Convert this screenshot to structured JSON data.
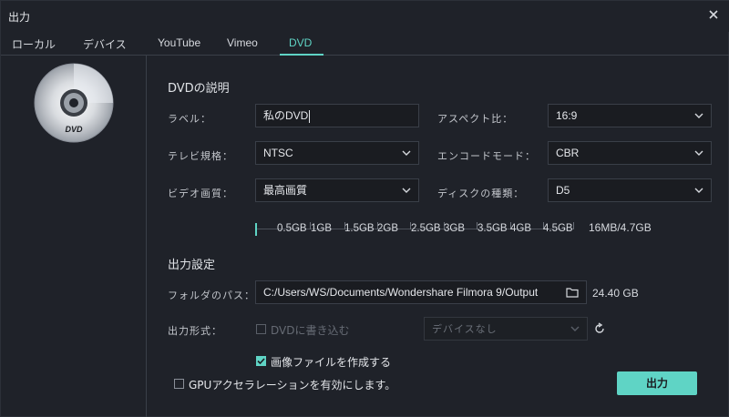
{
  "window": {
    "title": "出力"
  },
  "tabs": [
    {
      "label": "ローカル"
    },
    {
      "label": "デバイス"
    },
    {
      "label": "YouTube"
    },
    {
      "label": "Vimeo"
    },
    {
      "label": "DVD"
    }
  ],
  "dvd_description": {
    "section_title": "DVDの説明",
    "label_label": "ラベル：",
    "label_value": "私のDVD",
    "aspect_label": "アスペクト比：",
    "aspect_value": "16:9",
    "tv_label": "テレビ規格：",
    "tv_value": "NTSC",
    "encode_label": "エンコードモード：",
    "encode_value": "CBR",
    "quality_label": "ビデオ画質：",
    "quality_value": "最高画質",
    "disc_type_label": "ディスクの種類：",
    "disc_type_value": "D5"
  },
  "capacity": {
    "ticks": [
      "0.5GB",
      "1GB",
      "1.5GB",
      "2GB",
      "2.5GB",
      "3GB",
      "3.5GB",
      "4GB",
      "4.5GB"
    ],
    "summary": "16MB/4.7GB"
  },
  "output_settings": {
    "section_title": "出力設定",
    "folder_label": "フォルダのパス：",
    "folder_value": "C:/Users/WS/Documents/Wondershare Filmora 9/Output",
    "free_space": "24.40 GB",
    "format_label": "出力形式：",
    "burn_label": "DVDに書き込む",
    "device_placeholder": "デバイスなし",
    "image_file_label": "画像ファイルを作成する",
    "gpu_label": "GPUアクセラレーションを有効にします。",
    "export_label": "出力"
  },
  "disc_logo_text": "DVD",
  "colors": {
    "accent": "#5fd4c5",
    "background": "#1f2229",
    "field": "#1a1c21"
  },
  "states": {
    "image_file_checked": true,
    "gpu_checked": false,
    "burn_checked": false
  }
}
